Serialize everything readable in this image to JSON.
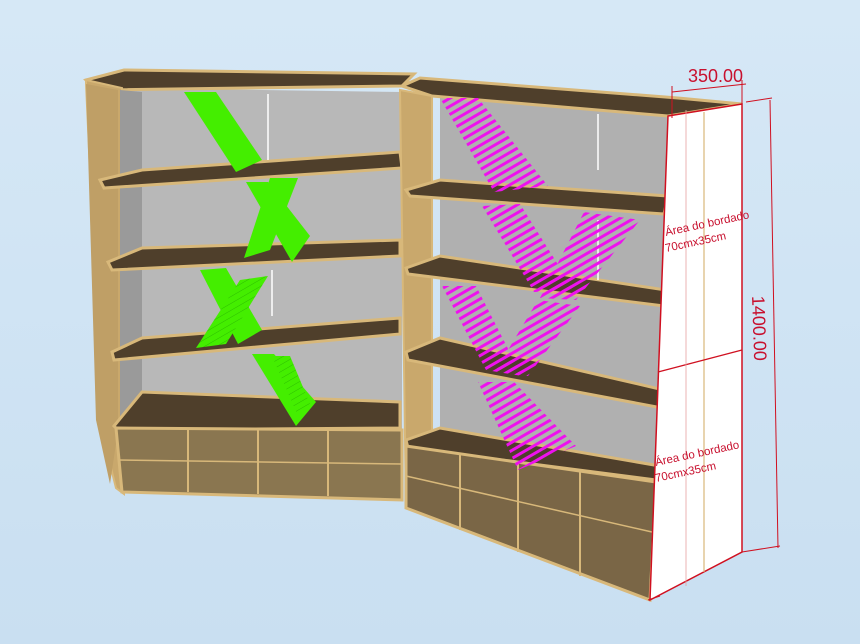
{
  "scene": {
    "dimension_width": "350.00",
    "dimension_height": "1400.00",
    "note_upper_line1": "Área do bordado",
    "note_upper_line2": "70cmx35cm",
    "note_lower_line1": "Área do bordado",
    "note_lower_line2": "70cmx35cm"
  },
  "colors": {
    "wood_edge": "#d8b87a",
    "wood_dark": "#4f3f2b",
    "back_panel": "#b5b5b5",
    "green_pattern": "#44ee00",
    "magenta_pattern": "#ee11ee",
    "dimension": "#d01020"
  }
}
